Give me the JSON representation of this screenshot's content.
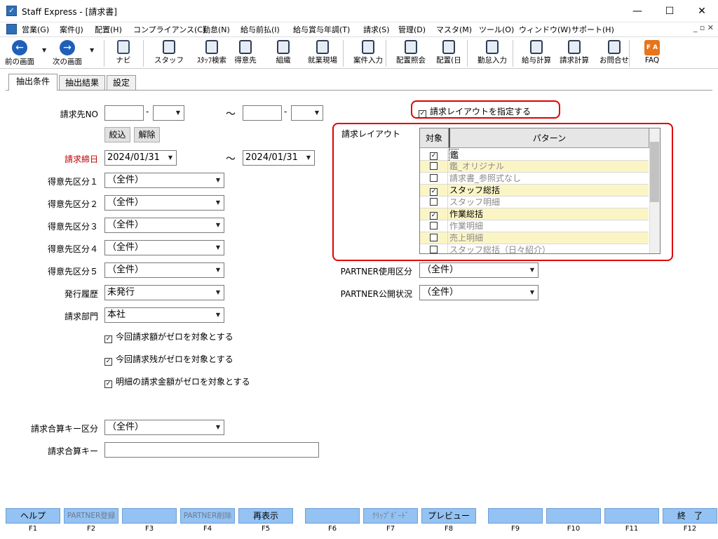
{
  "window": {
    "title": "Staff Express - [請求書]",
    "minimize": "—",
    "maximize": "☐",
    "close": "✕"
  },
  "menu": [
    "営業(G)",
    "案件(J)",
    "配置(H)",
    "コンプライアンス(C)",
    "勤怠(N)",
    "給与前払(I)",
    "給与賞与年調(T)",
    "請求(S)",
    "管理(D)",
    "マスタ(M)",
    "ツール(O)",
    "ウィンドウ(W)",
    "サポート(H)"
  ],
  "mdi_controls": "_ ▫ ✕",
  "toolbar": [
    {
      "label": "前の画面",
      "icon": "back-arrow-icon"
    },
    {
      "label": "次の画面",
      "icon": "forward-arrow-icon"
    },
    {
      "label": "ナビ",
      "icon": "navi-icon"
    },
    {
      "label": "スタッフ",
      "icon": "staff-icon"
    },
    {
      "label": "ｽﾀｯﾌ検索",
      "icon": "staff-search-icon"
    },
    {
      "label": "得意先",
      "icon": "customer-icon"
    },
    {
      "label": "組織",
      "icon": "organization-icon"
    },
    {
      "label": "就業現場",
      "icon": "worksite-icon"
    },
    {
      "label": "案件入力",
      "icon": "project-input-icon"
    },
    {
      "label": "配置照会",
      "icon": "placement-inquiry-icon"
    },
    {
      "label": "配置(日",
      "icon": "placement-daily-icon"
    },
    {
      "label": "勤怠入力",
      "icon": "attendance-input-icon"
    },
    {
      "label": "給与計算",
      "icon": "payroll-calc-icon"
    },
    {
      "label": "請求計算",
      "icon": "billing-calc-icon"
    },
    {
      "label": "お問合せ",
      "icon": "inquiry-icon"
    },
    {
      "label": "FAQ",
      "icon": "faq-icon"
    }
  ],
  "tabs": [
    "抽出条件",
    "抽出結果",
    "設定"
  ],
  "form": {
    "billing_no_label": "請求先NO",
    "tilde": "～",
    "dash": "-",
    "narrow_button": "絞込",
    "clear_button": "解除",
    "closing_date_label": "請求締日",
    "closing_date_from": "2024/01/31",
    "closing_date_to": "2024/01/31",
    "customer_class_1_label": "得意先区分１",
    "customer_class_2_label": "得意先区分２",
    "customer_class_3_label": "得意先区分３",
    "customer_class_4_label": "得意先区分４",
    "customer_class_5_label": "得意先区分５",
    "all_value": "（全件）",
    "issue_history_label": "発行履歴",
    "issue_history_value": "未発行",
    "billing_dept_label": "請求部門",
    "billing_dept_value": "本社",
    "check_zero_billing": "今回請求額がゼロを対象とする",
    "check_zero_balance": "今回請求残がゼロを対象とする",
    "check_zero_detail": "明細の請求金額がゼロを対象とする",
    "merge_key_class_label": "請求合算キー区分",
    "merge_key_label": "請求合算キー",
    "merge_key_value": "",
    "specify_layout_check": "請求レイアウトを指定する",
    "layout_label": "請求レイアウト",
    "partner_use_label": "PARTNER使用区分",
    "partner_public_label": "PARTNER公開状況"
  },
  "layout_grid": {
    "col_target": "対象",
    "col_pattern": "パターン",
    "rows": [
      {
        "name": "鑑",
        "checked": true
      },
      {
        "name": "鑑_オリジナル",
        "checked": false
      },
      {
        "name": "請求書_参照式なし",
        "checked": false
      },
      {
        "name": "スタッフ総括",
        "checked": true
      },
      {
        "name": "スタッフ明細",
        "checked": false
      },
      {
        "name": "作業総括",
        "checked": true
      },
      {
        "name": "作業明細",
        "checked": false
      },
      {
        "name": "売上明細",
        "checked": false
      },
      {
        "name": "スタッフ総括（日々紹介）",
        "checked": false
      }
    ]
  },
  "fkeys": [
    {
      "label": "ヘルプ",
      "key": "F1",
      "enabled": true
    },
    {
      "label": "PARTNER登録",
      "key": "F2",
      "enabled": false
    },
    {
      "label": "",
      "key": "F3",
      "enabled": true
    },
    {
      "label": "PARTNER削除",
      "key": "F4",
      "enabled": false
    },
    {
      "label": "再表示",
      "key": "F5",
      "enabled": true
    },
    {
      "label": "",
      "key": "F6",
      "enabled": true
    },
    {
      "label": "ｸﾘｯﾌﾟﾎﾞｰﾄﾞ",
      "key": "F7",
      "enabled": false
    },
    {
      "label": "プレビュー",
      "key": "F8",
      "enabled": true
    },
    {
      "label": "",
      "key": "F9",
      "enabled": true
    },
    {
      "label": "",
      "key": "F10",
      "enabled": true
    },
    {
      "label": "",
      "key": "F11",
      "enabled": true
    },
    {
      "label": "終　了",
      "key": "F12",
      "enabled": true
    }
  ]
}
